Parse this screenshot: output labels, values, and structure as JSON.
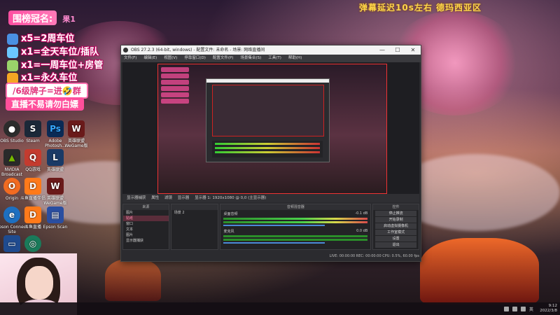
{
  "overlay": {
    "top_text": "弹幕延迟10s左右 德玛西亚区",
    "title_banner": "围榜冠名:",
    "title_banner_tail": "果1",
    "rules": [
      "x5=2周车位",
      "x1=全天车位/插队",
      "x1=一周车位+房管",
      "x1=永久车位"
    ],
    "pill_a": "/6级牌子=进🤣群",
    "pill_b": "直播不易请勿白嫖"
  },
  "desktop_icons": [
    {
      "label": "OBS Studio",
      "color": "#2c2c2c",
      "icon": "obs-icon"
    },
    {
      "label": "Steam",
      "color": "#1b2838",
      "icon": "steam-icon"
    },
    {
      "label": "Adobe Photosh...",
      "color": "#0a2a55",
      "icon": "photoshop-icon"
    },
    {
      "label": "英雄联盟 WeGame版",
      "color": "#6a1a1a",
      "icon": "wegame-icon"
    },
    {
      "label": "NVIDIA Broadcast",
      "color": "#2a2a2a",
      "icon": "nvidia-icon"
    },
    {
      "label": "QQ游戏",
      "color": "#c43b2f",
      "icon": "qqgame-icon"
    },
    {
      "label": "英雄联盟",
      "color": "#1a3a66",
      "icon": "lol-icon"
    },
    {
      "label": "Origin",
      "color": "#f26b21",
      "icon": "origin-icon"
    },
    {
      "label": "斗鱼直播伴侣",
      "color": "#ff7a1a",
      "icon": "douyu-icon"
    },
    {
      "label": "英雄联盟 WeGame版",
      "color": "#6a1a1a",
      "icon": "wegame-icon"
    },
    {
      "label": "Epson Connect Site",
      "color": "#1d6fc0",
      "icon": "epson-icon"
    },
    {
      "label": "斗鱼直播",
      "color": "#ff7a1a",
      "icon": "douyu-icon"
    },
    {
      "label": "Epson Scan",
      "color": "#2a4ea0",
      "icon": "scan-icon"
    }
  ],
  "obs": {
    "title": "OBS 27.2.3 (64-bit, windows) - 配置文件: 未命名 - 场景: 网络直播间",
    "menu": [
      "文件(F)",
      "编辑(E)",
      "视图(V)",
      "停靠窗口(D)",
      "配置文件(P)",
      "场景集合(S)",
      "工具(T)",
      "帮助(H)"
    ],
    "scene_bar_items": [
      "显示器捕获",
      "属性",
      "滤镜",
      "显示器",
      "显示器 1: 1920x1080 @ 0,0 (主显示器)"
    ],
    "dock_titles": {
      "scenes": "来源",
      "mixer": "音频混音器",
      "controls": "控件"
    },
    "sources": [
      "图片",
      "贴纸",
      "窗口",
      "文本",
      "图片",
      "显示器捕获"
    ],
    "scenes_label": "场景 2",
    "mixer_tracks": [
      {
        "name": "桌面音频",
        "db": "-0.1 dB"
      },
      {
        "name": "麦克风",
        "db": "0.0 dB"
      }
    ],
    "controls": [
      "停止推流",
      "开始录制",
      "启动虚拟摄像机",
      "工作室模式",
      "设置",
      "退出"
    ],
    "status": "LIVE: 00:00:00   REC: 00:00:00   CPU: 0.5%, 60.00 fps"
  },
  "taskbar": {
    "clock_time": "9:12",
    "clock_date": "2022/3/8",
    "tray_text": "英"
  }
}
